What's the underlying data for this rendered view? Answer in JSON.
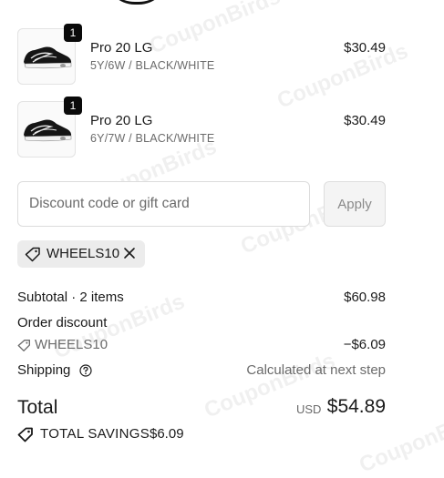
{
  "cart": {
    "items": [
      {
        "quantity": "1",
        "name": "Pro 20 LG",
        "variant": "5Y/6W / BLACK/WHITE",
        "price": "$30.49"
      },
      {
        "quantity": "1",
        "name": "Pro 20 LG",
        "variant": "6Y/7W / BLACK/WHITE",
        "price": "$30.49"
      }
    ]
  },
  "discount": {
    "placeholder": "Discount code or gift card",
    "apply_label": "Apply",
    "applied_code": "WHEELS10"
  },
  "summary": {
    "subtotal_label": "Subtotal · 2 items",
    "subtotal_value": "$60.98",
    "order_discount_label": "Order discount",
    "discount_code": "WHEELS10",
    "discount_value": "−$6.09",
    "shipping_label": "Shipping",
    "shipping_value": "Calculated at next step",
    "total_label": "Total",
    "currency": "USD",
    "total_value": "$54.89",
    "savings_label": "TOTAL SAVINGS",
    "savings_value": "$6.09"
  },
  "watermark": {
    "text": "CouponBirds"
  },
  "icons": {
    "tag": "tag-icon",
    "close": "close-icon",
    "help": "help-circle-icon",
    "savings": "savings-tag-icon"
  }
}
